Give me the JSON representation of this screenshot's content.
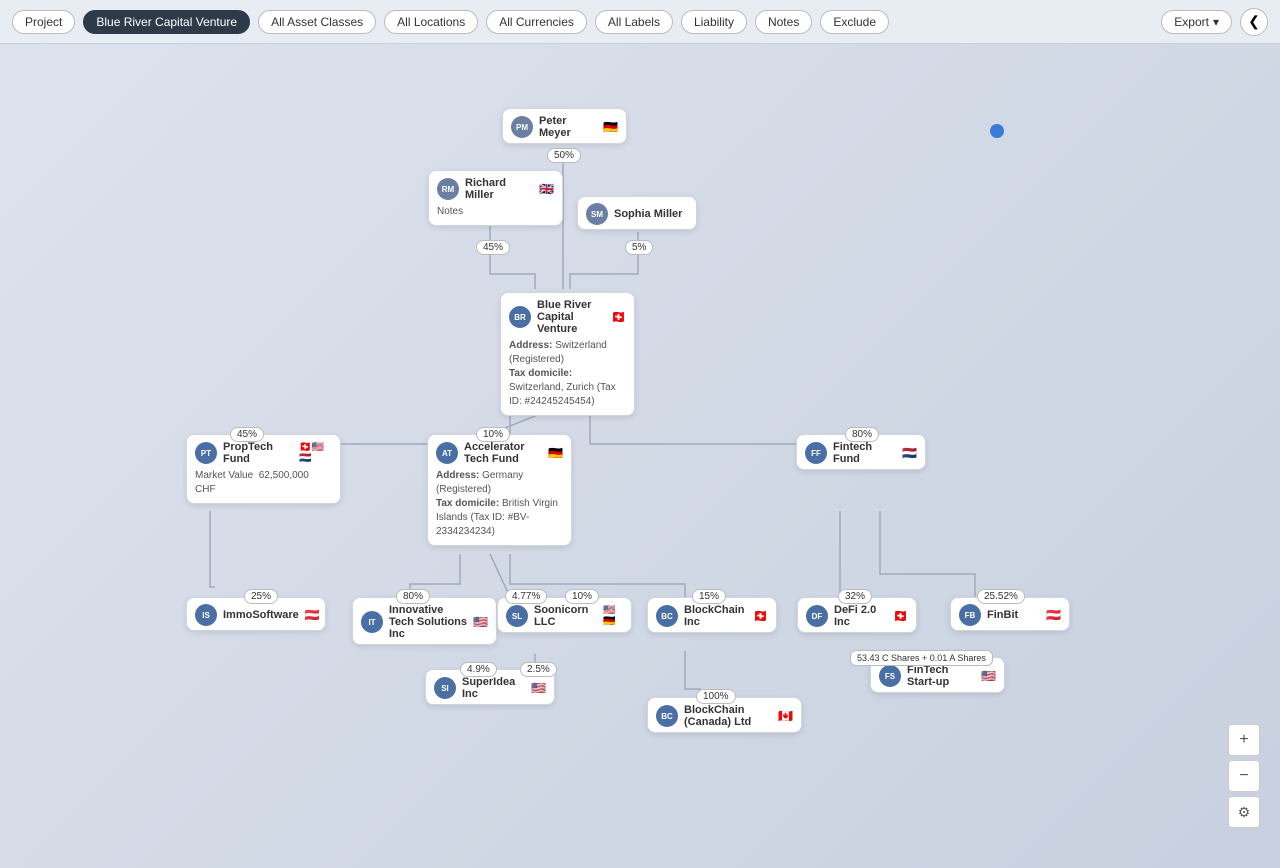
{
  "topbar": {
    "project_label": "Project",
    "active_filter": "Blue River Capital Venture",
    "filters": [
      "All Asset Classes",
      "All Locations",
      "All Currencies",
      "All Labels"
    ],
    "right_btns": [
      "Liability",
      "Notes",
      "Exclude"
    ],
    "export_label": "Export",
    "collapse_icon": "❮"
  },
  "zoom": {
    "plus": "+",
    "minus": "−",
    "settings": "⚙"
  },
  "nodes": {
    "peter_meyer": {
      "initials": "PM",
      "name": "Peter Meyer",
      "flag": "🇩🇪",
      "avatar_color": "#6b7fa3"
    },
    "richard_miller": {
      "initials": "RM",
      "name": "Richard Miller",
      "flag": "🇬🇧",
      "notes": "Notes",
      "avatar_color": "#6b7fa3"
    },
    "sophia_miller": {
      "initials": "SM",
      "name": "Sophia Miller",
      "avatar_color": "#6b7fa3"
    },
    "blue_river": {
      "initials": "BR",
      "name": "Blue River Capital Venture",
      "flag": "🇨🇭",
      "address_label": "Address:",
      "address": "Switzerland (Registered)",
      "tax_label": "Tax domicile:",
      "tax": "Switzerland, Zurich (Tax ID: #24245245454)",
      "avatar_color": "#4a6fa5"
    },
    "proptech": {
      "initials": "PT",
      "name": "PropTech Fund",
      "flags": "🇨🇭🇺🇸🇳🇱",
      "mv_label": "Market Value",
      "mv": "62,500,000 CHF",
      "avatar_color": "#4a6fa5"
    },
    "accelerator": {
      "initials": "AT",
      "name": "Accelerator Tech Fund",
      "flag": "🇩🇪",
      "address_label": "Address:",
      "address": "Germany (Registered)",
      "tax_label": "Tax domicile:",
      "tax": "British Virgin Islands (Tax ID: #BV-2334234234)",
      "avatar_color": "#4a6fa5"
    },
    "fintech_fund": {
      "initials": "FF",
      "name": "Fintech Fund",
      "flag": "🇳🇱",
      "avatar_color": "#4a6fa5"
    },
    "immo": {
      "initials": "IS",
      "name": "ImmoSoftware",
      "flag": "🇦🇹",
      "avatar_color": "#4a6fa5"
    },
    "innovative": {
      "initials": "IT",
      "name": "Innovative Tech Solutions Inc",
      "flag": "🇺🇸",
      "avatar_color": "#4a6fa5"
    },
    "soonicorn": {
      "initials": "SL",
      "name": "Soonicorn LLC",
      "flags": "🇺🇸🇩🇪",
      "avatar_color": "#4a6fa5"
    },
    "blockchain_inc": {
      "initials": "BC",
      "name": "BlockChain Inc",
      "flag": "🇨🇭",
      "avatar_color": "#4a6fa5"
    },
    "defi": {
      "initials": "DF",
      "name": "DeFi 2.0 Inc",
      "flag": "🇨🇭",
      "avatar_color": "#4a6fa5"
    },
    "finbit": {
      "initials": "FB",
      "name": "FinBit",
      "flag": "🇦🇹",
      "avatar_color": "#4a6fa5"
    },
    "superidea": {
      "initials": "SI",
      "name": "SuperIdea Inc",
      "flag": "🇺🇸",
      "avatar_color": "#4a6fa5"
    },
    "blockchain_ca": {
      "initials": "BC",
      "name": "BlockChain (Canada) Ltd",
      "flag": "🇨🇦",
      "avatar_color": "#4a6fa5"
    },
    "fintech_startup": {
      "initials": "FS",
      "name": "FinTech Start-up",
      "flag": "🇺🇸",
      "shares": "53.43 C Shares + 0.01 A Shares",
      "avatar_color": "#4a6fa5"
    }
  },
  "percentages": {
    "peter_to_blue": "50%",
    "richard_to_blue": "45%",
    "sophia_to_blue": "5%",
    "blue_to_proptech": "45%",
    "blue_to_accelerator": "10%",
    "blue_to_fintech": "80%",
    "proptech_to_immo": "25%",
    "accelerator_to_innovative": "80%",
    "accelerator_to_soonicorn_left": "4.77%",
    "accelerator_to_soonicorn_right": "10%",
    "accelerator_to_blockchain": "15%",
    "defi_pct": "32%",
    "finbit_pct": "25.52%",
    "soonicorn_to_superidea_left": "4.9%",
    "soonicorn_to_superidea_right": "2.5%",
    "blockchain_to_ca": "100%"
  }
}
